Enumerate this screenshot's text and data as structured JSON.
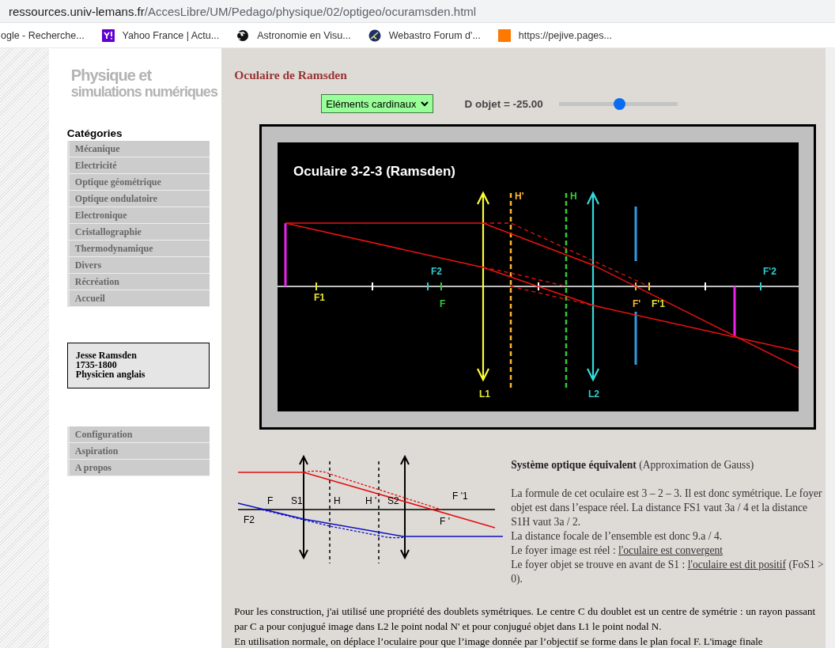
{
  "browser": {
    "url_host": "ressources.univ-lemans.fr",
    "url_path": "/AccesLibre/UM/Pedago/physique/02/optigeo/ocuramsden.html",
    "bookmarks": [
      {
        "label": "ogle - Recherche...",
        "kind": "none"
      },
      {
        "label": "Yahoo France | Actu...",
        "kind": "yahoo"
      },
      {
        "label": "Astronomie en Visu...",
        "kind": "spiral"
      },
      {
        "label": "Webastro Forum d'...",
        "kind": "globe"
      },
      {
        "label": "https://pejive.pages...",
        "kind": "orange"
      }
    ]
  },
  "sidebar": {
    "logo_lines": [
      "Physique et",
      "simulations numériques"
    ],
    "categories_title": "Catégories",
    "categories": [
      "Mécanique",
      "Electricité",
      "Optique géométrique",
      "Optique ondulatoire",
      "Electronique",
      "Cristallographie",
      "Thermodynamique",
      "Divers",
      "Récréation",
      "Accueil"
    ],
    "info_lines": [
      "Jesse Ramsden",
      "1735-1800",
      "Physicien anglais"
    ],
    "links": [
      "Configuration",
      "Aspiration",
      "A propos"
    ]
  },
  "main": {
    "title": "Oculaire de Ramsden",
    "view_select": {
      "value": "Eléments cardinaux"
    },
    "d_object": {
      "label": "D objet = -25.00",
      "level": 0.51
    },
    "simulation": {
      "title": "Oculaire 3-2-3 (Ramsden)",
      "labels": [
        {
          "text": "H'",
          "color": "#ffb733"
        },
        {
          "text": "H",
          "color": "#33cc33"
        },
        {
          "text": "F2",
          "color": "#33cccc"
        },
        {
          "text": "F",
          "color": "#33cc33"
        },
        {
          "text": "F1",
          "color": "#e6e633"
        },
        {
          "text": "F'",
          "color": "#ffb733"
        },
        {
          "text": "F'1",
          "color": "#e6e633"
        },
        {
          "text": "F'2",
          "color": "#33cccc"
        },
        {
          "text": "L1",
          "color": "#e6e633"
        },
        {
          "text": "L2",
          "color": "#33cccc"
        }
      ]
    },
    "schema_labels": [
      "F",
      "S1",
      "H",
      "H '",
      "S2",
      "F '1",
      "F2",
      "F '"
    ],
    "equivalent": {
      "heading": "**Système optique équivalent** (Approximation de Gauss)",
      "lines": [
        {
          "text": "La formule de cet oculaire est 3 – 2 – 3. Il est donc symétrique. Le foyer objet est dans l’espace réel. La distance FS1 vaut 3a / 4 et la distance S1H vaut 3a / 2."
        },
        {
          "text": "La distance focale de l’ensemble est donc 9.a / 4."
        },
        {
          "text": "Le foyer image est réel : ",
          "link": "l'oculaire est convergent"
        },
        {
          "text": "Le foyer objet se trouve en avant de S1 : ",
          "link": "l'oculaire est dit positif",
          "after": " (FoS1 > 0)."
        }
      ]
    },
    "paragraphs": [
      "Pour les construction, j'ai utilisé une propriété des doublets symétriques. Le centre C du doublet est un centre de symétrie : un rayon passant par C a pour conjugué image dans L2 le point nodal N' et pour conjugué objet dans L1 le point nodal N.",
      "En utilisation normale, on déplace l’oculaire pour que l’image donnée par l’objectif se forme dans le plan focal F. L'image finale"
    ]
  }
}
